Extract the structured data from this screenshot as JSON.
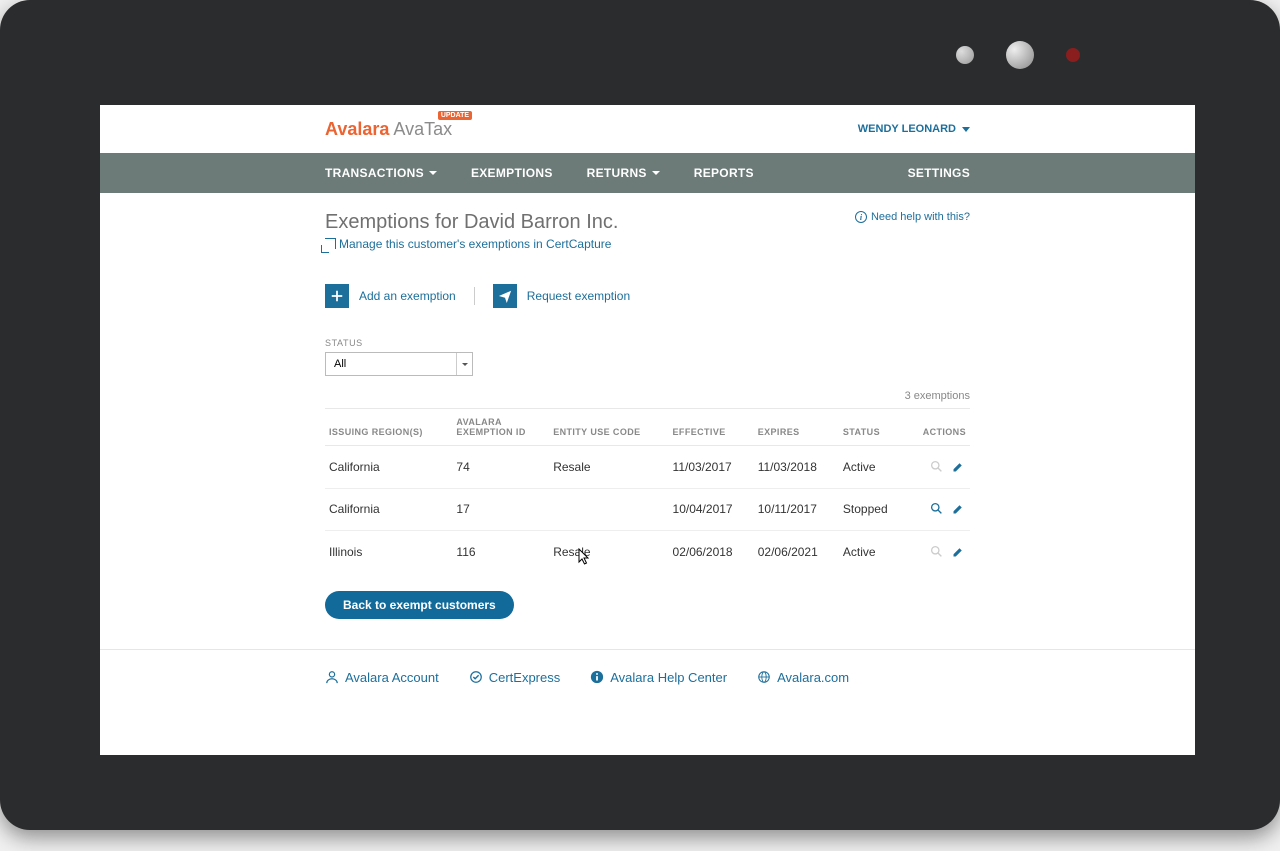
{
  "logo": {
    "brand": "Avalara",
    "product": "AvaTax",
    "badge": "UPDATE"
  },
  "user": {
    "name": "WENDY LEONARD"
  },
  "nav": {
    "transactions": "TRANSACTIONS",
    "exemptions": "EXEMPTIONS",
    "returns": "RETURNS",
    "reports": "REPORTS",
    "settings": "SETTINGS"
  },
  "page": {
    "title": "Exemptions for David Barron Inc.",
    "manage_link": "Manage this customer's exemptions in CertCapture",
    "help": "Need help with this?",
    "add_label": "Add an exemption",
    "request_label": "Request exemption"
  },
  "filter": {
    "label": "STATUS",
    "value": "All"
  },
  "count_label": "3 exemptions",
  "columns": {
    "region": "ISSUING REGION(S)",
    "avalara1": "AVALARA",
    "avalara2": "EXEMPTION ID",
    "entity": "ENTITY USE CODE",
    "effective": "EFFECTIVE",
    "expires": "EXPIRES",
    "status": "STATUS",
    "actions": "ACTIONS"
  },
  "rows": [
    {
      "region": "California",
      "id": "74",
      "entity": "Resale",
      "effective": "11/03/2017",
      "expires": "11/03/2018",
      "status": "Active",
      "search_active": false
    },
    {
      "region": "California",
      "id": "17",
      "entity": "",
      "effective": "10/04/2017",
      "expires": "10/11/2017",
      "status": "Stopped",
      "search_active": true
    },
    {
      "region": "Illinois",
      "id": "116",
      "entity": "Resale",
      "effective": "02/06/2018",
      "expires": "02/06/2021",
      "status": "Active",
      "search_active": false
    }
  ],
  "back_button": "Back to exempt customers",
  "footer": {
    "account": "Avalara Account",
    "certexpress": "CertExpress",
    "help": "Avalara Help Center",
    "site": "Avalara.com"
  }
}
